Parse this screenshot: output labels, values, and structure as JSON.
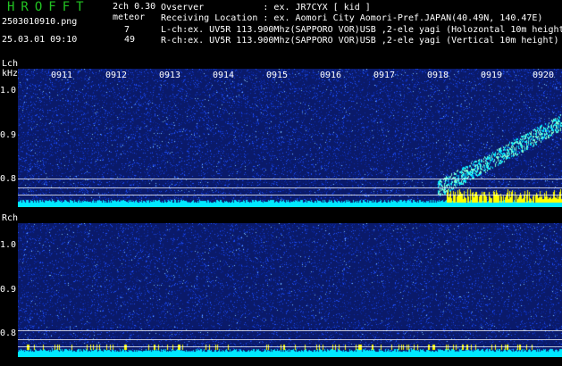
{
  "header": {
    "app_title": "HROFFT",
    "file_name": "2503010910.png",
    "datetime": "25.03.01 09:10",
    "mode": "2ch 0.30",
    "meteor_label": "meteor",
    "lch_count": "7",
    "rch_count": "49",
    "observer": "Ovserver           : ex. JR7CYX [ kid ]",
    "location": "Receiving Location : ex. Aomori City Aomori-Pref.JAPAN(40.49N, 140.47E)",
    "lch_info": "L-ch:ex. UV5R 113.900Mhz(SAPPORO VOR)USB ,2-ele yagi (Holozontal 10m height)",
    "rch_info": "R-ch:ex. UV5R 113.900Mhz(SAPPORO VOR)USB ,2-ele yagi (Vertical 10m height)"
  },
  "lch_panel": {
    "label": "Lch",
    "unit": "kHz",
    "y_ticks": [
      "1.0",
      "0.9",
      "0.8"
    ],
    "time_ticks": [
      "0911",
      "0912",
      "0913",
      "0914",
      "0915",
      "0916",
      "0917",
      "0918",
      "0919",
      "0920"
    ]
  },
  "rch_panel": {
    "label": "Rch",
    "y_ticks": [
      "1.0",
      "0.9",
      "0.8"
    ]
  },
  "colors": {
    "title_green": "#22c322",
    "background": "#000000",
    "noise_dark": "#0a1a6a",
    "noise_mid": "#1e50ff",
    "signal_cyan": "#00e8ff",
    "signal_yellow": "#ffff00"
  }
}
